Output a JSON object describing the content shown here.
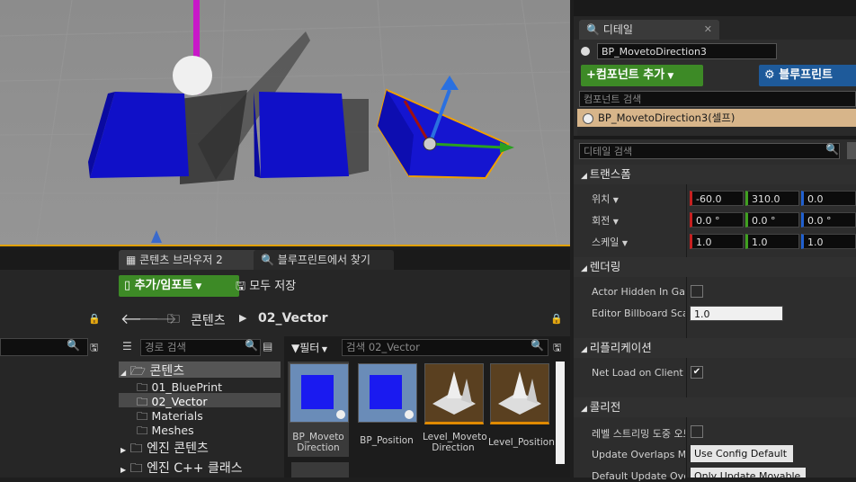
{
  "details": {
    "tab_label": "디테일",
    "actor_name": "BP_MovetoDirection3",
    "add_component_label": "컴포넌트 추가",
    "blueprint_label": "블루프린트",
    "component_search_placeholder": "컴포넌트 검색",
    "component_self": "BP_MovetoDirection3(셀프)",
    "detail_search_placeholder": "디테일 검색",
    "transform_header": "트랜스폼",
    "location_label": "위치",
    "rotation_label": "회전",
    "scale_label": "스케일",
    "location": [
      "-60.0",
      "310.0",
      "0.0"
    ],
    "rotation": [
      "0.0 °",
      "0.0 °",
      "0.0 °"
    ],
    "scale": [
      "1.0",
      "1.0",
      "1.0"
    ],
    "rendering_header": "렌더링",
    "actor_hidden_label": "Actor Hidden In Game",
    "billboard_label": "Editor Billboard Scale",
    "billboard_value": "1.0",
    "replication_header": "리플리케이션",
    "net_load_label": "Net Load on Client",
    "collision_header": "콜리전",
    "level_streaming_label": "레벨 스트리밍 도중 오브",
    "update_overlaps_label": "Update Overlaps Met",
    "update_overlaps_value": "Use Config Default",
    "default_update_label": "Default Update Overl",
    "default_update_value": "Only Update Movable"
  },
  "content_browser": {
    "tab1": "콘텐츠 브라우저 2",
    "tab2": "블루프린트에서 찾기",
    "add_import": "추가/임포트",
    "save_all": "모두 저장",
    "breadcrumb_root": "콘텐츠",
    "breadcrumb_folder": "02_Vector",
    "path_search_placeholder": "경로 검색",
    "filter_label": "필터",
    "asset_search_placeholder": "검색 02_Vector",
    "tree": [
      {
        "label": "콘텐츠",
        "level": 0
      },
      {
        "label": "01_BluePrint",
        "level": 1
      },
      {
        "label": "02_Vector",
        "level": 1
      },
      {
        "label": "Materials",
        "level": 1
      },
      {
        "label": "Meshes",
        "level": 1
      },
      {
        "label": "엔진 콘텐츠",
        "level": 0
      },
      {
        "label": "엔진 C++ 클래스",
        "level": 0
      }
    ],
    "assets": [
      {
        "label": "BP_Moveto Direction",
        "kind": "blueprint"
      },
      {
        "label": "BP_Position",
        "kind": "blueprint"
      },
      {
        "label": "Level_Moveto Direction",
        "kind": "level"
      },
      {
        "label": "Level_Position",
        "kind": "level"
      }
    ]
  },
  "colors": {
    "accent": "#e0a000",
    "green": "#3d8a26",
    "blue": "#1e5a9a",
    "selected_bg": "#d7b58a"
  }
}
